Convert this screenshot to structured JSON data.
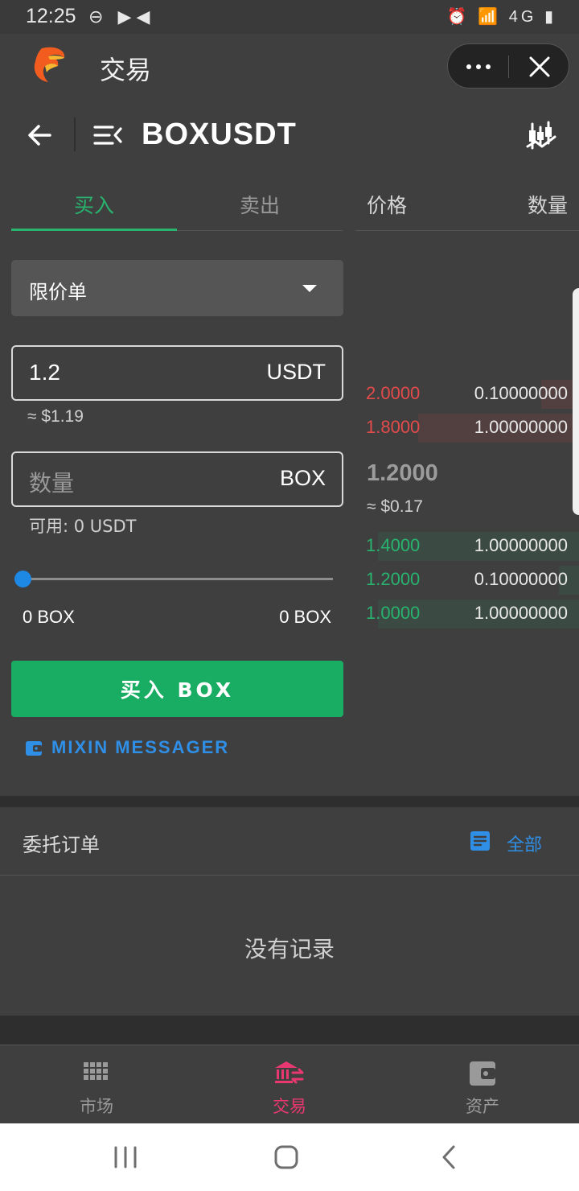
{
  "status_bar": {
    "time": "12:25",
    "left_icons": "⊖ ▶◀",
    "right_icons": "⏰ 📶 4G ▮"
  },
  "app_header": {
    "title": "交易"
  },
  "nav": {
    "pair": "BOXUSDT"
  },
  "tabs": {
    "buy": "买入",
    "sell": "卖出"
  },
  "order_book_header": {
    "price": "价格",
    "qty": "数量"
  },
  "order_form": {
    "order_type": "限价单",
    "price_value": "1.2",
    "price_unit": "USDT",
    "price_approx": "≈ $1.19",
    "qty_placeholder": "数量",
    "qty_unit": "BOX",
    "available": "可用: 0 USDT",
    "slider_value": 0,
    "slider_min_label": "0 BOX",
    "slider_max_label": "0 BOX",
    "submit_label": "买入 BOX",
    "wallet_label": "MIXIN MESSAGER"
  },
  "order_book": {
    "asks": [
      {
        "price": "2.0000",
        "qty": "0.10000000",
        "depth": 0.17
      },
      {
        "price": "1.8000",
        "qty": "1.00000000",
        "depth": 0.72
      }
    ],
    "last_price": "1.2000",
    "last_approx": "≈ $0.17",
    "bids": [
      {
        "price": "1.4000",
        "qty": "1.00000000",
        "depth": 0.9
      },
      {
        "price": "1.2000",
        "qty": "0.10000000",
        "depth": 0.09
      },
      {
        "price": "1.0000",
        "qty": "1.00000000",
        "depth": 0.9
      }
    ]
  },
  "orders": {
    "title": "委托订单",
    "all_label": "全部",
    "empty": "没有记录"
  },
  "tabbar": {
    "items": [
      {
        "label": "市场",
        "icon": "grid-icon",
        "active": false
      },
      {
        "label": "交易",
        "icon": "bank-exchange-icon",
        "active": true
      },
      {
        "label": "资产",
        "icon": "wallet-icon",
        "active": false
      }
    ]
  },
  "colors": {
    "buy_green": "#19ad63",
    "sell_red": "#e34b4b",
    "link_blue": "#2f8fe6",
    "active_tab_pink": "#e8386f",
    "background": "#3f3f40"
  }
}
